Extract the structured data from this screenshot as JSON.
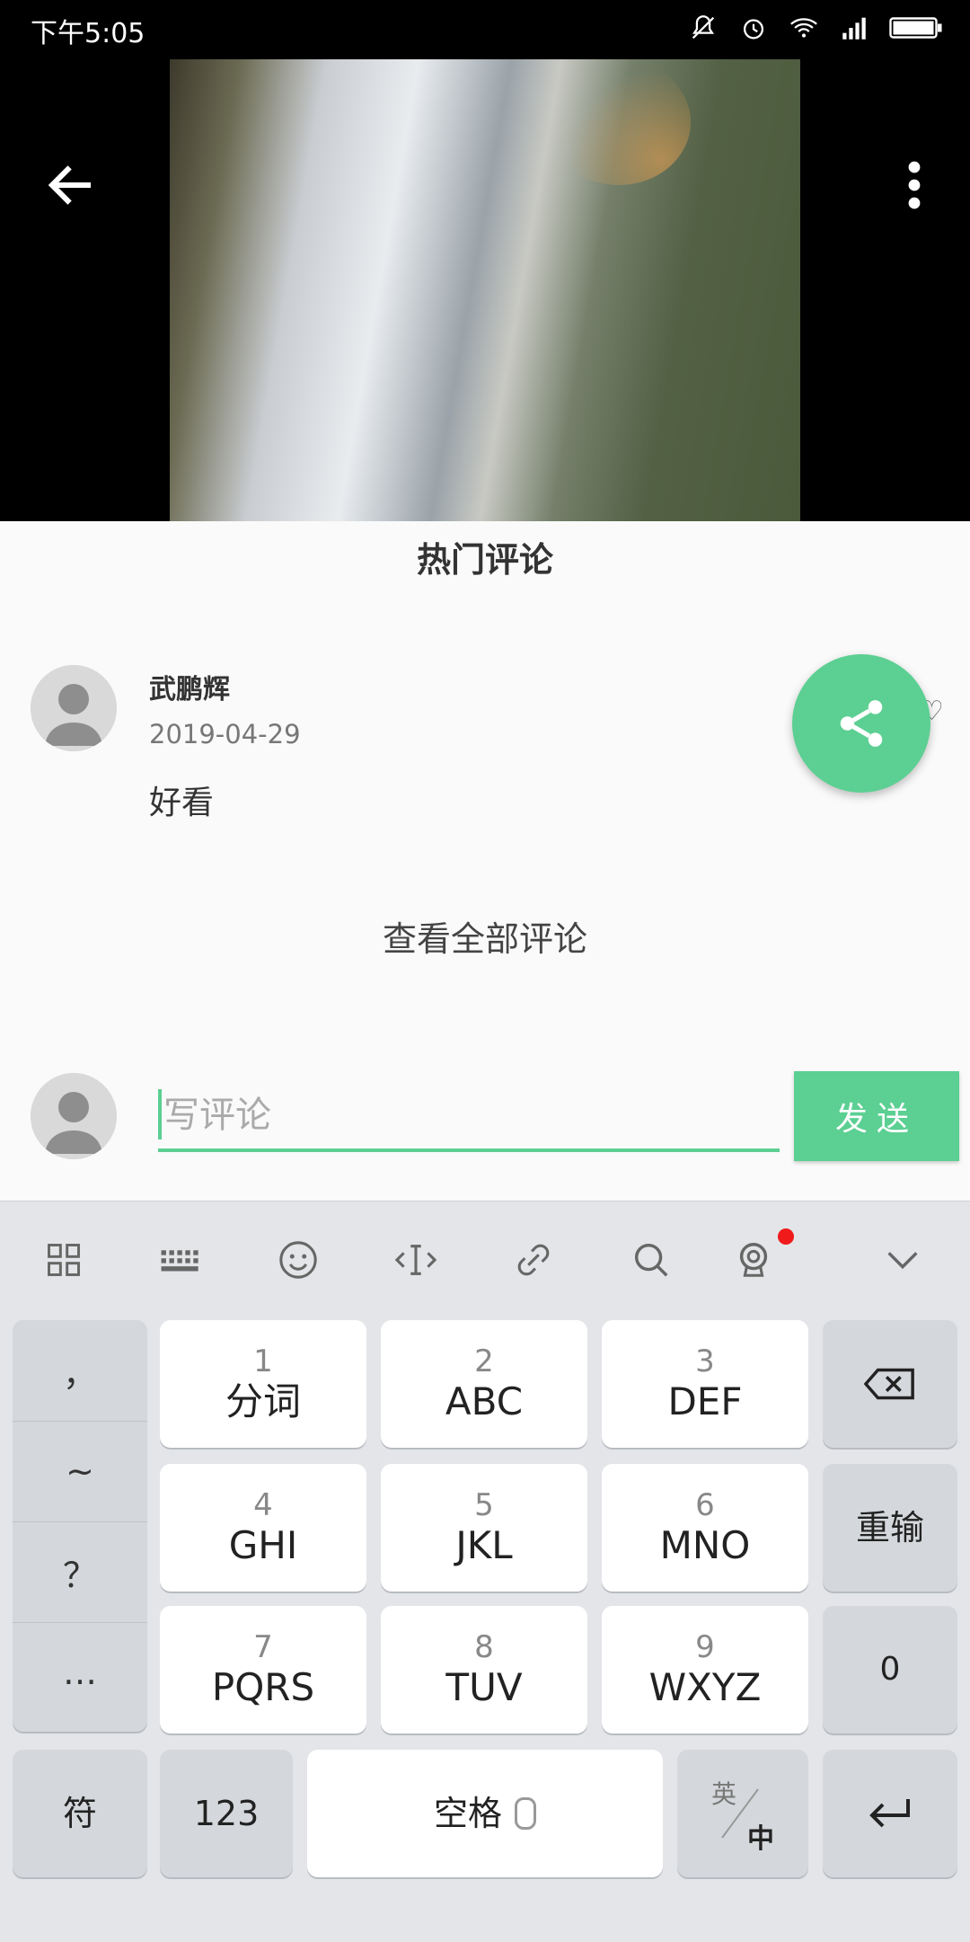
{
  "status_bar": {
    "time": "下午5:05",
    "icons": [
      "mute-icon",
      "alarm-icon",
      "wifi-icon",
      "signal-icon",
      "battery-icon"
    ]
  },
  "header": {
    "back_icon": "back-arrow-icon",
    "more_icon": "more-vert-icon"
  },
  "comments": {
    "section_title": "热门评论",
    "items": [
      {
        "author": "武鹏辉",
        "date": "2019-04-29",
        "text": "好看"
      }
    ],
    "view_all_label": "查看全部评论"
  },
  "composer": {
    "placeholder": "写评论",
    "send_label": "发送"
  },
  "keyboard": {
    "toolbar_icons": [
      "grid-icon",
      "keyboard-icon",
      "emoji-icon",
      "cursor-icon",
      "link-icon",
      "search-icon",
      "voice-assistant-icon",
      "collapse-icon"
    ],
    "punct_keys": [
      "，",
      "~",
      "？",
      "…"
    ],
    "keys": [
      {
        "num": "1",
        "label": "分词"
      },
      {
        "num": "2",
        "label": "ABC"
      },
      {
        "num": "3",
        "label": "DEF"
      },
      {
        "num": "4",
        "label": "GHI"
      },
      {
        "num": "5",
        "label": "JKL"
      },
      {
        "num": "6",
        "label": "MNO"
      },
      {
        "num": "7",
        "label": "PQRS"
      },
      {
        "num": "8",
        "label": "TUV"
      },
      {
        "num": "9",
        "label": "WXYZ"
      }
    ],
    "right_keys": {
      "retype": "重输",
      "zero": "0"
    },
    "bottom": {
      "symbol": "符",
      "numbers": "123",
      "space": "空格",
      "lang_top": "英",
      "lang_bottom": "中"
    }
  },
  "colors": {
    "accent": "#5ccf92",
    "notification_dot": "#f01a1a"
  }
}
